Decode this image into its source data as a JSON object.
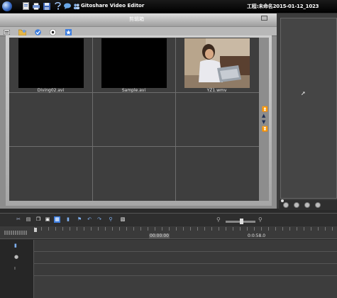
{
  "window": {
    "app_title": "Gitoshare Video Editor",
    "project_title": "工程:未命名2015-01-12_1023"
  },
  "toolbar_icons": [
    "new-file-icon",
    "print-icon",
    "save-icon",
    "help-icon",
    "chat-icon",
    "users-icon"
  ],
  "album": {
    "title": "剪辑箱",
    "tools": [
      "folder-icon",
      "check-icon",
      "record-icon",
      "star-icon"
    ],
    "items": [
      {
        "label": "Diving02.avi",
        "thumbnail": "black"
      },
      {
        "label": "Sample.avi",
        "thumbnail": "black"
      },
      {
        "label": "YZ1.wmv",
        "thumbnail": "woman-with-laptop"
      }
    ]
  },
  "timeline": {
    "time_start": "00:00:00",
    "time_end": "0:0:58.0",
    "tools": [
      "cut-icon",
      "paste-icon",
      "copy-icon",
      "duplicate-icon",
      "image-icon",
      "marker-icon",
      "flag-icon",
      "undo-icon",
      "redo-icon",
      "pin-icon",
      "document-icon"
    ],
    "tracks": [
      "video-track-icon",
      "audio-track-icon",
      "text-track-icon"
    ]
  },
  "colors": {
    "accent": "#3a6cc6",
    "panel_bg": "#8d8d8d",
    "grid_bg": "#3e3e3e"
  }
}
